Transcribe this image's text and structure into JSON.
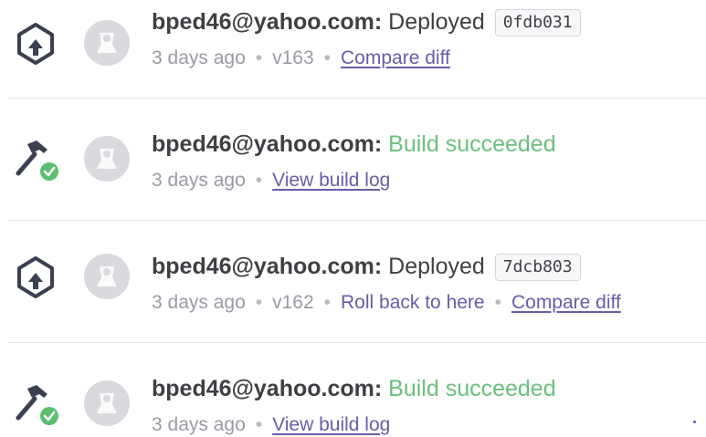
{
  "entries": [
    {
      "type": "deploy",
      "icon": "deploy-icon",
      "actor": "bped46@yahoo.com:",
      "status": "Deployed",
      "commit": "0fdb031",
      "time": "3 days ago",
      "version": "v163",
      "compare_label": "Compare diff"
    },
    {
      "type": "build",
      "icon": "build-success-icon",
      "actor": "bped46@yahoo.com:",
      "status": "Build succeeded",
      "time": "3 days ago",
      "build_log_label": "View build log"
    },
    {
      "type": "deploy",
      "icon": "deploy-icon",
      "actor": "bped46@yahoo.com:",
      "status": "Deployed",
      "commit": "7dcb803",
      "time": "3 days ago",
      "version": "v162",
      "rollback_label": "Roll back to here",
      "compare_label": "Compare diff"
    },
    {
      "type": "build",
      "icon": "build-success-icon",
      "actor": "bped46@yahoo.com:",
      "status": "Build succeeded",
      "time": "3 days ago",
      "build_log_label": "View build log"
    }
  ],
  "separator": "•",
  "colors": {
    "text": "#3f3f44",
    "muted": "#9a9aa6",
    "link": "#6b5ba8",
    "success": "#6cbf7d",
    "avatar_bg": "#d9d9de",
    "icon": "#3b3f52"
  }
}
